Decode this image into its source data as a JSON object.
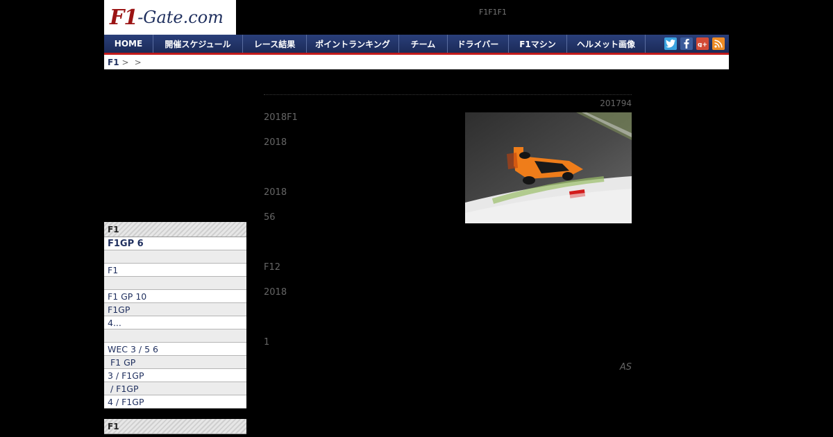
{
  "logo": {
    "f1": "F1",
    "rest": "-Gate.com"
  },
  "tagline": "F1F1F1",
  "nav": [
    {
      "label": "HOME",
      "w": 70
    },
    {
      "label": "開催スケジュール",
      "w": 128
    },
    {
      "label": "レース結果",
      "w": 91
    },
    {
      "label": "ポイントランキング",
      "w": 132
    },
    {
      "label": "チーム",
      "w": 69
    },
    {
      "label": "ドライバー",
      "w": 87
    },
    {
      "label": "F1マシン",
      "w": 83
    },
    {
      "label": "ヘルメット画像",
      "w": 112
    }
  ],
  "social": {
    "twitter": "t",
    "facebook": "f",
    "google": "g+",
    "rss": "rss"
  },
  "breadcrumb": {
    "home": "F1",
    "sep1": ">",
    "sep2": ">"
  },
  "sidebar": {
    "head1": "F1",
    "items": [
      "F1GP 6",
      "",
      "F1",
      "",
      "F1 GP 10",
      "F1GP",
      "4...",
      "",
      "WEC 3 / 5 6",
      " F1 GP",
      "3 / F1GP",
      " / F1GP",
      "4 / F1GP"
    ],
    "head2": "F1"
  },
  "article": {
    "date": "201794",
    "paragraphs": [
      "2018F1",
      "2018",
      "2018",
      "56",
      "F12",
      "2018",
      "1"
    ],
    "credit": "AS"
  }
}
